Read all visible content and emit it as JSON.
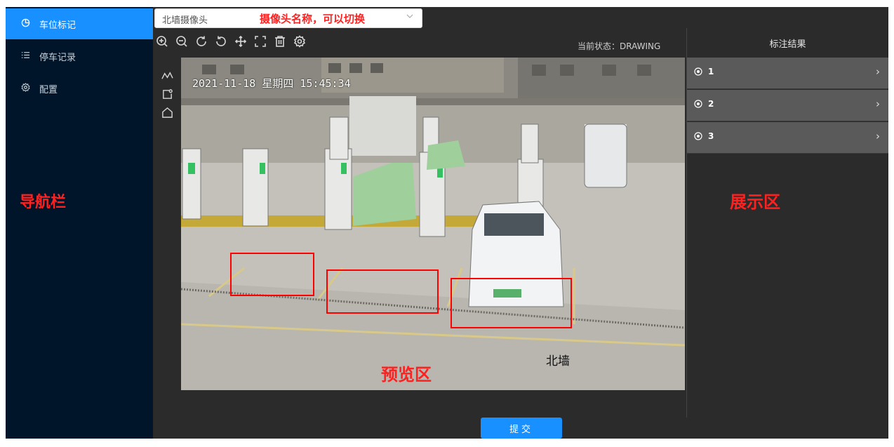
{
  "sidebar": {
    "items": [
      {
        "label": "车位标记",
        "icon": "pie-chart-icon",
        "active": true
      },
      {
        "label": "停车记录",
        "icon": "list-icon",
        "active": false
      },
      {
        "label": "配置",
        "icon": "gear-icon",
        "active": false
      }
    ]
  },
  "annotations": {
    "nav": "导航栏",
    "camera": "摄像头名称，可以切换",
    "preview": "预览区",
    "display": "展示区"
  },
  "camera_select": {
    "value": "北墙摄像头"
  },
  "toolbar": {
    "tools": [
      "zoom-in-icon",
      "zoom-out-icon",
      "rotate-cw-icon",
      "rotate-ccw-icon",
      "move-icon",
      "fullscreen-icon",
      "delete-icon",
      "settings-icon"
    ]
  },
  "status": {
    "text": "当前状态：DRAWING"
  },
  "draw_tools": [
    "polyline-icon",
    "rect-icon",
    "polygon-icon"
  ],
  "preview": {
    "timestamp": "2021-11-18 星期四 15:45:34",
    "camera_label": "北墙"
  },
  "results": {
    "header": "标注结果",
    "items": [
      {
        "label": "1"
      },
      {
        "label": "2"
      },
      {
        "label": "3"
      }
    ]
  },
  "submit_label": "提交",
  "colors": {
    "sidebar": "#001529",
    "accent": "#1890ff",
    "annotation": "#ff2020",
    "panel": "#2b2b2b"
  }
}
